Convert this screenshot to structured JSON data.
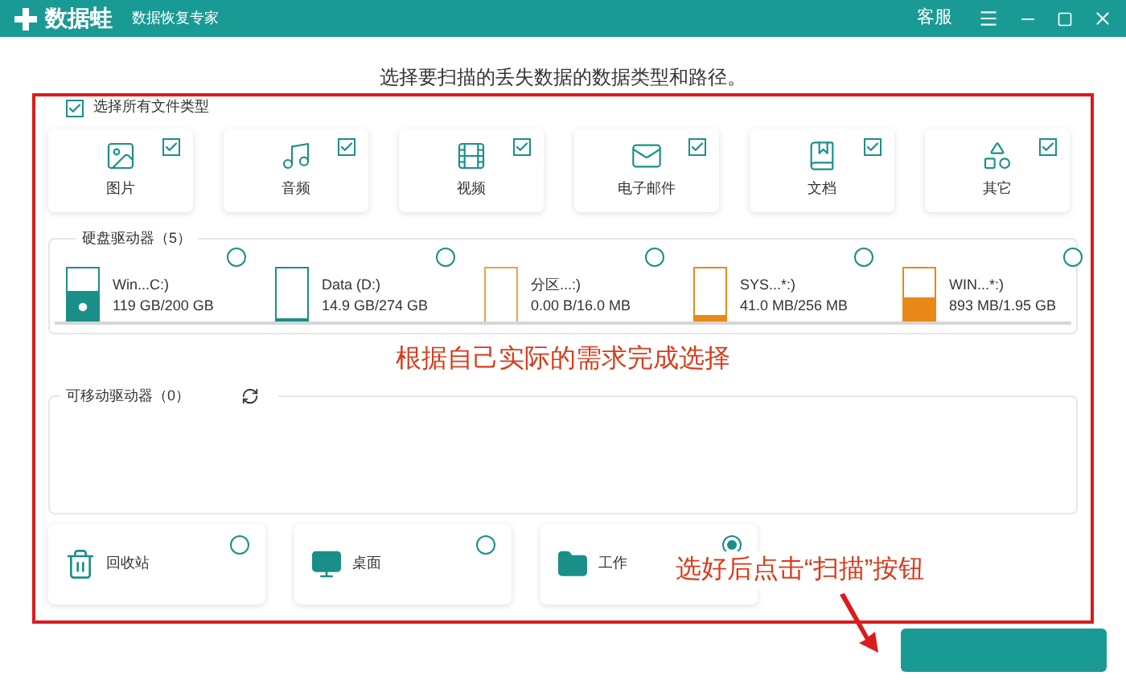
{
  "header": {
    "logo_text": "数据蛙",
    "subtitle": "数据恢复专家",
    "service": "客服"
  },
  "heading": "选择要扫描的丢失数据的数据类型和路径。",
  "select_all": {
    "label": "选择所有文件类型",
    "checked": true
  },
  "categories": [
    {
      "kind": "image",
      "label": "图片",
      "checked": true
    },
    {
      "kind": "audio",
      "label": "音频",
      "checked": true
    },
    {
      "kind": "video",
      "label": "视频",
      "checked": true
    },
    {
      "kind": "email",
      "label": "电子邮件",
      "checked": true
    },
    {
      "kind": "document",
      "label": "文档",
      "checked": true
    },
    {
      "kind": "other",
      "label": "其它",
      "checked": true
    }
  ],
  "drives": {
    "title": "硬盘驱动器（5）",
    "items": [
      {
        "name": "Win...C:)",
        "usage": "119 GB/200 GB",
        "level": 0.6,
        "color": "#1a8f8a",
        "system": true,
        "selected": false
      },
      {
        "name": "Data (D:)",
        "usage": "14.9 GB/274 GB",
        "level": 0.05,
        "color": "#1a8f8a",
        "system": false,
        "selected": false
      },
      {
        "name": "分区...:)",
        "usage": "0.00  B/16.0 MB",
        "level": 0,
        "color": "#f0a040",
        "system": false,
        "selected": false
      },
      {
        "name": "SYS...*:)",
        "usage": "41.0 MB/256 MB",
        "level": 0.16,
        "color": "#e8891a",
        "system": false,
        "selected": false
      },
      {
        "name": "WIN...*:)",
        "usage": "893 MB/1.95 GB",
        "level": 0.46,
        "color": "#e8891a",
        "system": false,
        "selected": false
      }
    ]
  },
  "removable": {
    "title": "可移动驱动器（0）"
  },
  "locations": [
    {
      "kind": "recycle",
      "label": "回收站",
      "selected": false
    },
    {
      "kind": "desktop",
      "label": "桌面",
      "selected": false
    },
    {
      "kind": "folder",
      "label": "工作",
      "selected": true
    }
  ],
  "annotations": [
    "根据自己实际的需求完成选择",
    "选好后点击“扫描”按钮"
  ]
}
